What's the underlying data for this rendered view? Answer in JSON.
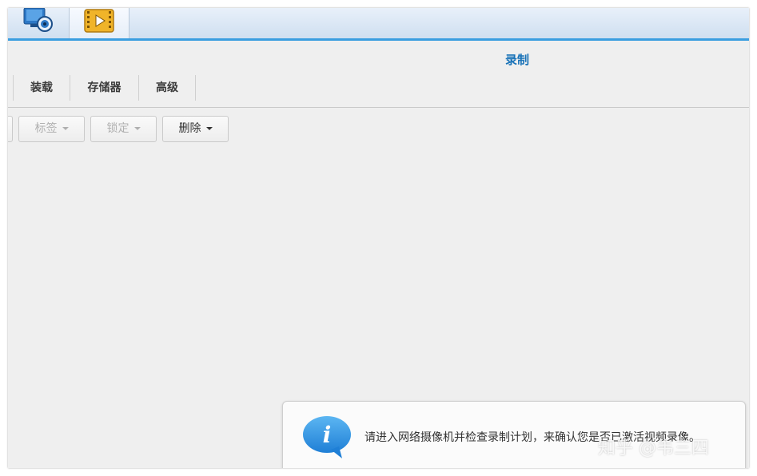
{
  "taskbar": {
    "apps": [
      {
        "name": "surveillance-app",
        "icon": "camera-monitor-icon"
      },
      {
        "name": "media-app",
        "icon": "film-play-icon"
      }
    ]
  },
  "header": {
    "title": "录制"
  },
  "tabs": [
    {
      "label": "装载"
    },
    {
      "label": "存储器"
    },
    {
      "label": "高级"
    }
  ],
  "toolbar": {
    "tag_label": "标签",
    "lock_label": "锁定",
    "delete_label": "删除"
  },
  "notice": {
    "icon": "info-bubble-icon",
    "text": "请进入网络摄像机并检查录制计划，来确认您是否已激活视频录像。"
  },
  "watermark": {
    "text": "知乎 @韦三四"
  },
  "colors": {
    "accent": "#3a9ee0",
    "title": "#1a73b8",
    "info_icon": "#2a8fe0"
  }
}
